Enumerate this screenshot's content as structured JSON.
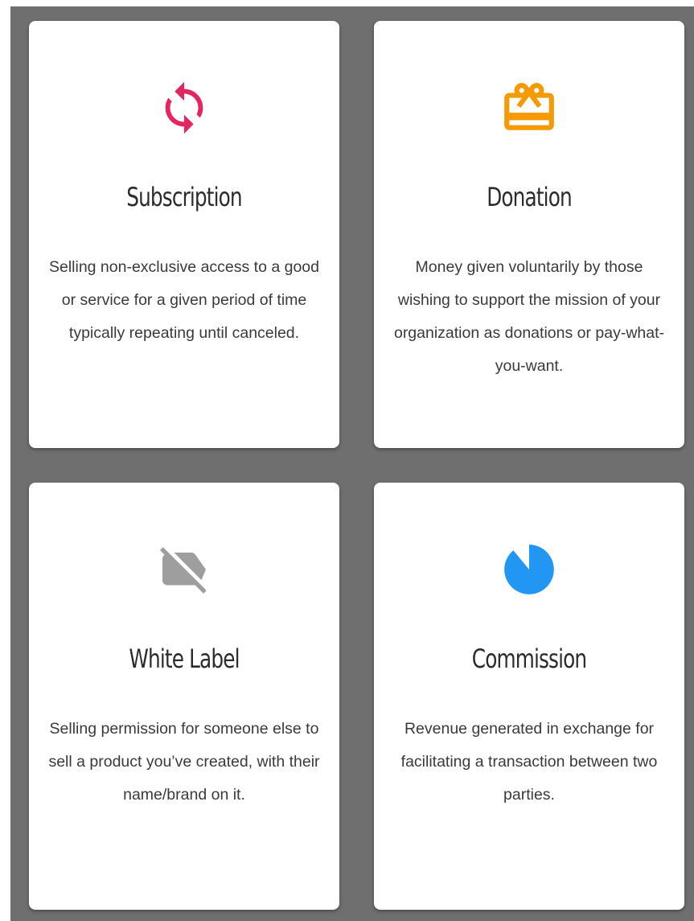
{
  "cards": [
    {
      "title": "Subscription",
      "description": "Selling non-exclusive access to a good or service for a given period of time typically repeating until canceled.",
      "icon": "sync-icon",
      "icon_color": "#e3265f"
    },
    {
      "title": "Donation",
      "description": "Money given voluntarily by those wishing to support the mission of your organization as donations or pay-what-you-want.",
      "icon": "gift-card-icon",
      "icon_color": "#f39a05"
    },
    {
      "title": "White Label",
      "description": "Selling permission for someone else to sell a product you’ve created, with their name/brand on it.",
      "icon": "label-off-icon",
      "icon_color": "#9e9e9e"
    },
    {
      "title": "Commission",
      "description": "Revenue generated in exchange for facilitating a transaction between two parties.",
      "icon": "pie-chart-icon",
      "icon_color": "#2196f3"
    }
  ]
}
